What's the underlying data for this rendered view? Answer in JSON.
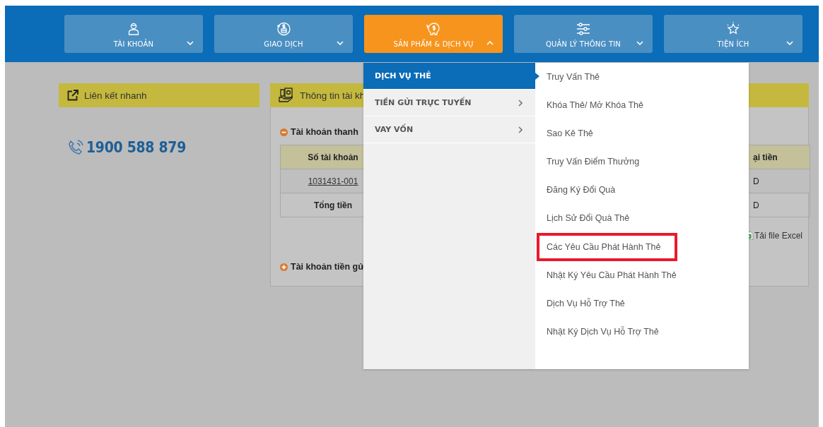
{
  "nav": [
    {
      "label": "TÀI KHOẢN",
      "expanded": false
    },
    {
      "label": "GIAO DỊCH",
      "expanded": false
    },
    {
      "label": "SẢN PHẨM & DỊCH VỤ",
      "expanded": true
    },
    {
      "label": "QUẢN LÝ THÔNG TIN",
      "expanded": false
    },
    {
      "label": "TIỆN ÍCH",
      "expanded": false
    }
  ],
  "quick_links": {
    "title": "Liên kết nhanh",
    "hotline": "1900 588 879"
  },
  "account_info": {
    "title": "Thông tin tài kh",
    "sections": [
      {
        "title": "Tài khoản thanh",
        "expanded": true
      },
      {
        "title": "Tài khoản tiền gử",
        "expanded": false
      }
    ],
    "table": {
      "columns": [
        "Số tài khoản",
        "ại tiền"
      ],
      "rows": [
        {
          "kind": "account",
          "cells": [
            "1031431-001",
            "D"
          ]
        },
        {
          "kind": "total",
          "cells": [
            "Tổng tiền",
            "D"
          ]
        }
      ]
    },
    "export_link": "Tải file Excel"
  },
  "menu": {
    "categories": [
      {
        "label": "DỊCH VỤ THẺ",
        "selected": true
      },
      {
        "label": "TIỀN GỬI TRỰC TUYẾN",
        "selected": false
      },
      {
        "label": "VAY VỐN",
        "selected": false
      }
    ],
    "items": [
      {
        "label": "Truy Vấn Thẻ",
        "highlighted": false
      },
      {
        "label": "Khóa Thẻ/ Mở Khóa Thẻ",
        "highlighted": false
      },
      {
        "label": "Sao Kê Thẻ",
        "highlighted": false
      },
      {
        "label": "Truy Vấn Điểm Thưởng",
        "highlighted": false
      },
      {
        "label": "Đăng Ký Đổi Quà",
        "highlighted": false
      },
      {
        "label": "Lịch Sử Đổi Quà Thẻ",
        "highlighted": false
      },
      {
        "label": "Các Yêu Cầu Phát Hành Thẻ",
        "highlighted": true
      },
      {
        "label": "Nhật Ký Yêu Cầu Phát Hành Thẻ",
        "highlighted": false
      },
      {
        "label": "Dịch Vụ Hỗ Trợ Thẻ",
        "highlighted": false
      },
      {
        "label": "Nhật Ký Dịch Vụ Hỗ Trợ Thẻ",
        "highlighted": false
      }
    ]
  }
}
